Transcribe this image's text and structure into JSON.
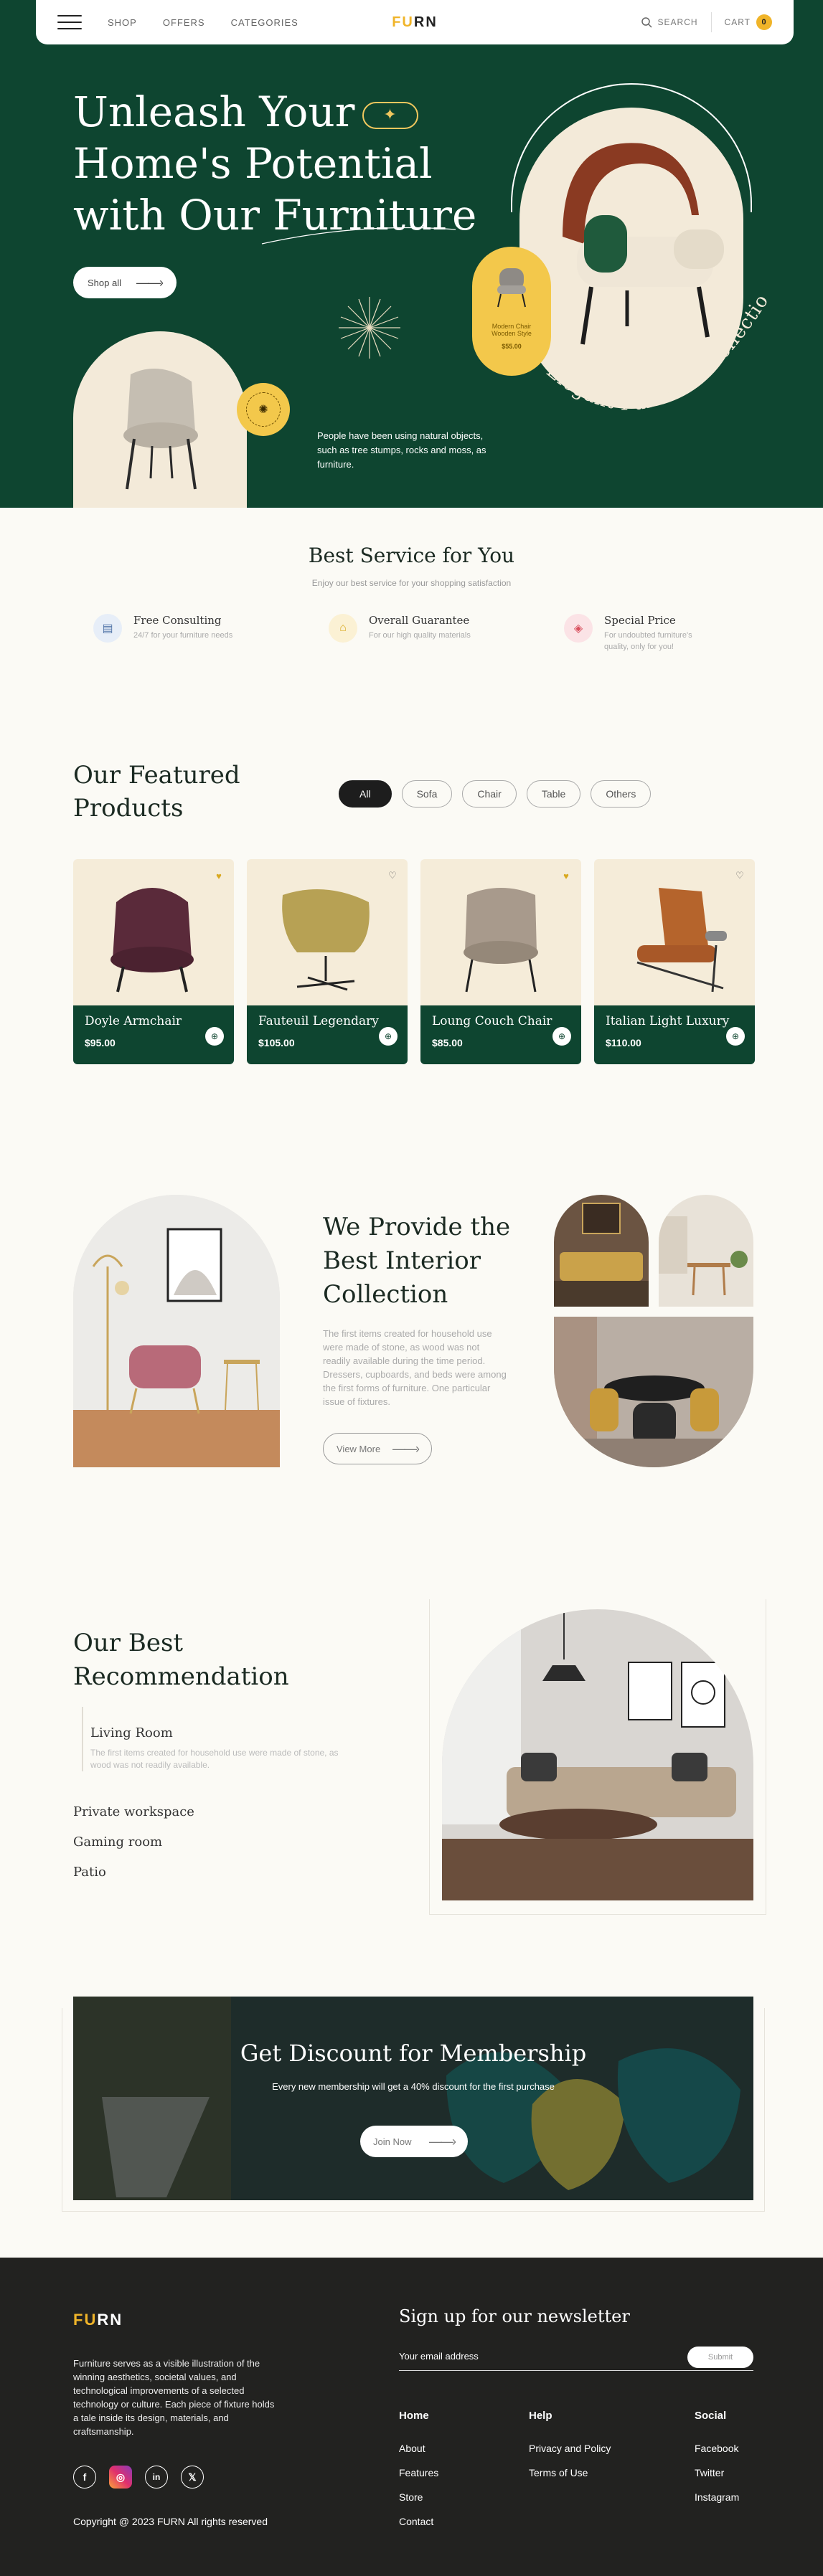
{
  "nav": {
    "links": [
      "SHOP",
      "OFFERS",
      "CATEGORIES"
    ],
    "logo_fu": "FU",
    "logo_rn": "RN",
    "search": "SEARCH",
    "cart": "CART",
    "cart_count": "0"
  },
  "hero": {
    "line1": "Unleash Your",
    "line2": "Home's Potential",
    "line3": "with Our Furniture",
    "shop_all": "Shop all",
    "description": "People have been using natural objects, such as tree stumps, rocks and moss, as furniture.",
    "pill_text": "Modern Chair Wooden Style",
    "pill_price": "$55.00",
    "curved_text": "Elegant Furniture Collections"
  },
  "service": {
    "title": "Best Service for You",
    "subtitle": "Enjoy our best service for your shopping satisfaction",
    "items": [
      {
        "name": "Free Consulting",
        "desc": "24/7 for your furniture needs"
      },
      {
        "name": "Overall Guarantee",
        "desc": "For our high quality materials"
      },
      {
        "name": "Special Price",
        "desc": "For undoubted furniture's quality, only for you!"
      }
    ]
  },
  "featured": {
    "title1": "Our Featured",
    "title2": "Products",
    "filters": [
      "All",
      "Sofa",
      "Chair",
      "Table",
      "Others"
    ],
    "products": [
      {
        "name": "Doyle Armchair",
        "price": "$95.00",
        "color": "#5a2a3a"
      },
      {
        "name": "Fauteuil Legendary",
        "price": "$105.00",
        "color": "#b7a154"
      },
      {
        "name": "Loung Couch Chair",
        "price": "$85.00",
        "color": "#a89a8c"
      },
      {
        "name": "Italian Light Luxury",
        "price": "$110.00",
        "color": "#b5642c"
      }
    ]
  },
  "interior": {
    "title1": "We Provide the",
    "title2": "Best Interior",
    "title3": "Collection",
    "desc": "The first items created for household use were made of stone, as wood was not readily available during the time period. Dressers, cupboards, and beds were among the first forms of furniture. One particular issue of fixtures.",
    "view_more": "View More"
  },
  "recommend": {
    "title1": "Our Best",
    "title2": "Recommendation",
    "active_item": "Living Room",
    "active_desc": "The first items created for household use were made of stone, as wood was not readily available.",
    "items": [
      "Private workspace",
      "Gaming room",
      "Patio"
    ]
  },
  "discount": {
    "title": "Get Discount for Membership",
    "subtitle": "Every new membership will get a 40% discount for the first purchase",
    "button": "Join Now"
  },
  "footer": {
    "logo_fu": "FU",
    "logo_rn": "RN",
    "desc": "Furniture serves as a visible illustration of the winning aesthetics, societal values, and technological improvements of a selected technology or culture. Each piece of fixture holds a tale inside its design, materials, and craftsmanship.",
    "copyright": "Copyright @ 2023 FURN All rights reserved",
    "newsletter_title": "Sign up for our newsletter",
    "email_placeholder": "Your email address",
    "submit": "Submit",
    "home_title": "Home",
    "home_links": [
      "About",
      "Features",
      "Store",
      "Contact"
    ],
    "help_title": "Help",
    "help_links": [
      "Privacy and Policy",
      "Terms of Use"
    ],
    "social_title": "Social",
    "social_links": [
      "Facebook",
      "Twitter",
      "Instagram"
    ]
  }
}
